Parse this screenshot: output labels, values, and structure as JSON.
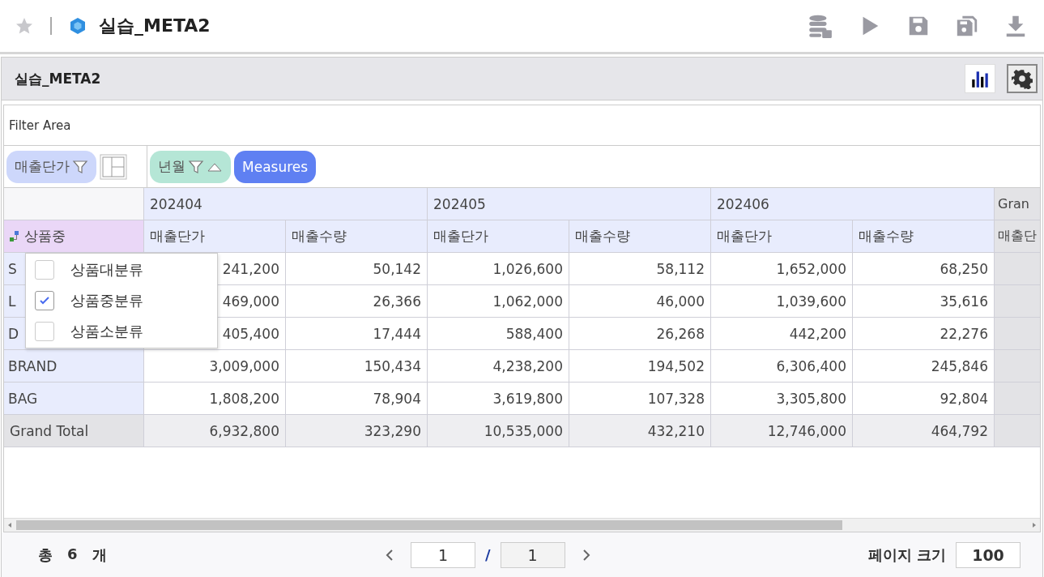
{
  "header": {
    "title": "실습_META2"
  },
  "panel": {
    "title": "실습_META2"
  },
  "filter_area": {
    "label": "Filter Area"
  },
  "pills": [
    {
      "label": "매출단가",
      "kind": "data",
      "sort": false
    },
    {
      "label": "년월",
      "kind": "column",
      "sort": true
    },
    {
      "label": "Measures",
      "kind": "measures",
      "sort": false
    }
  ],
  "table": {
    "row_header": "상품중",
    "column_groups": [
      "202404",
      "202405",
      "202406",
      "Gran"
    ],
    "measures": [
      "매출단가",
      "매출수량",
      "매출단가",
      "매출수량",
      "매출단가",
      "매출수량",
      "매출단"
    ],
    "rows": [
      {
        "label": "S",
        "kind": "row",
        "values": [
          "241,200",
          "50,142",
          "1,026,600",
          "58,112",
          "1,652,000",
          "68,250"
        ]
      },
      {
        "label": "L",
        "kind": "row",
        "values": [
          "469,000",
          "26,366",
          "1,062,000",
          "46,000",
          "1,039,600",
          "35,616"
        ]
      },
      {
        "label": "D",
        "kind": "row",
        "values": [
          "405,400",
          "17,444",
          "588,400",
          "26,268",
          "442,200",
          "22,276"
        ]
      },
      {
        "label": "BRAND",
        "kind": "row",
        "values": [
          "3,009,000",
          "150,434",
          "4,238,200",
          "194,502",
          "6,306,400",
          "245,846"
        ]
      },
      {
        "label": "BAG",
        "kind": "row",
        "values": [
          "1,808,200",
          "78,904",
          "3,619,800",
          "107,328",
          "3,305,800",
          "92,804"
        ]
      },
      {
        "label": "Grand Total",
        "kind": "total",
        "values": [
          "6,932,800",
          "323,290",
          "10,535,000",
          "432,210",
          "12,746,000",
          "464,792"
        ]
      }
    ]
  },
  "dropdown": {
    "items": [
      {
        "label": "상품대분류",
        "checked": false
      },
      {
        "label": "상품중분류",
        "checked": true
      },
      {
        "label": "상품소분류",
        "checked": false
      }
    ]
  },
  "footer": {
    "total_label": "총",
    "count": "6",
    "unit": "개",
    "page": "1",
    "separator": "/",
    "pages": "1",
    "page_size_label": "페이지 크기",
    "page_size": "100"
  }
}
